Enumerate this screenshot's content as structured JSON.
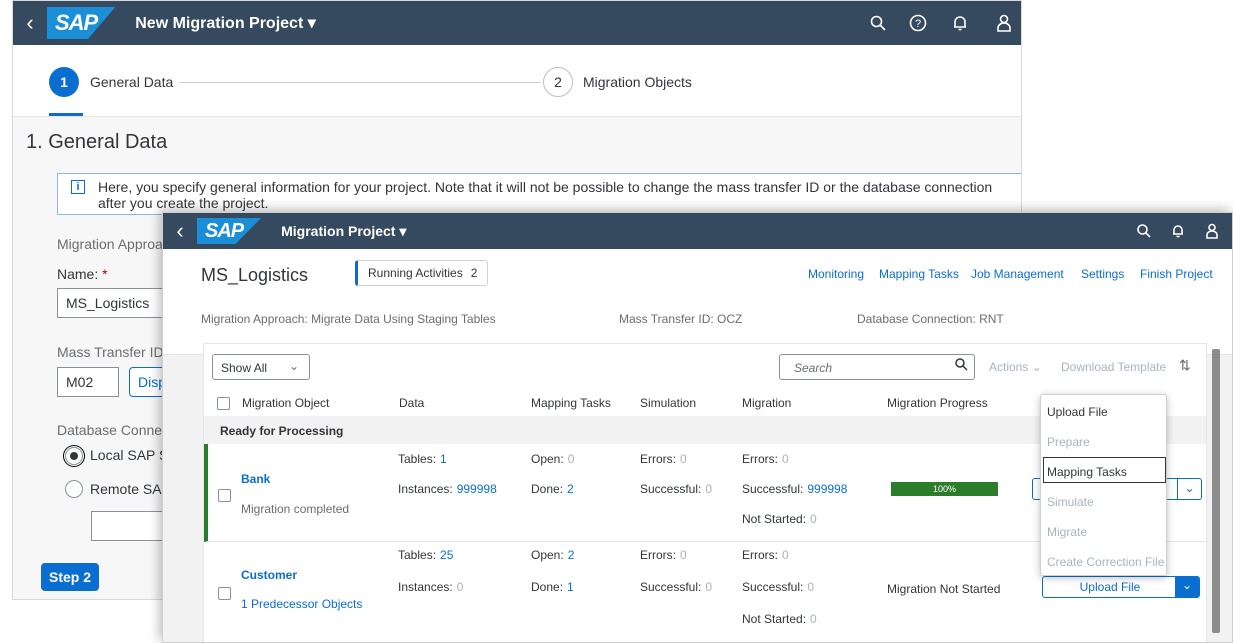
{
  "back": {
    "shell": {
      "title": "New Migration Project ▾",
      "logo": "SAP"
    },
    "steps": [
      {
        "number": "1",
        "label": "General Data"
      },
      {
        "number": "2",
        "label": "Migration Objects"
      }
    ],
    "heading": "1. General Data",
    "info_line1": "Here, you specify general information for your project. Note that it will not be possible to change the mass transfer ID or the database connection",
    "info_line2": "after you create the project.",
    "migration_approach_label": "Migration Approa",
    "name_label": "Name:",
    "name_required": "*",
    "name_value": "MS_Logistics",
    "mass_transfer_label": "Mass Transfer ID",
    "mass_transfer_value": "M02",
    "display_button": "Disp",
    "db_connection_label": "Database Conne",
    "radio_local": "Local SAP S",
    "radio_remote": "Remote SAI",
    "step2_button": "Step 2"
  },
  "front": {
    "shell": {
      "title": "Migration Project ▾",
      "logo": "SAP"
    },
    "project_name": "MS_Logistics",
    "running_activities": {
      "label": "Running Activities",
      "count": "2"
    },
    "header_links": [
      "Monitoring",
      "Mapping Tasks",
      "Job Management",
      "Settings",
      "Finish Project"
    ],
    "migration_approach": "Migration Approach: Migrate Data Using Staging Tables",
    "mass_transfer_id": "Mass Transfer ID: OCZ",
    "database_connection": "Database Connection: RNT",
    "toolbar": {
      "show_all": "Show All",
      "search_placeholder": "Search",
      "actions": "Actions",
      "download_template": "Download Template"
    },
    "columns": [
      "Migration Object",
      "Data",
      "Mapping Tasks",
      "Simulation",
      "Migration",
      "Migration Progress"
    ],
    "group_header": "Ready for Processing",
    "rows": [
      {
        "name": "Bank",
        "sub": "Migration completed",
        "tables_label": "Tables:",
        "tables": "1",
        "instances_label": "Instances:",
        "instances": "999998",
        "open_label": "Open:",
        "open": "0",
        "done_label": "Done:",
        "done": "2",
        "sim_errors_label": "Errors:",
        "sim_errors": "0",
        "sim_success_label": "Successful:",
        "sim_success": "0",
        "mig_errors_label": "Errors:",
        "mig_errors": "0",
        "mig_success_label": "Successful:",
        "mig_success": "999998",
        "mig_notstarted_label": "Not Started:",
        "mig_notstarted": "0",
        "progress_text": "100%",
        "progress_fraction": 1.0
      },
      {
        "name": "Customer",
        "sub": "1 Predecessor Objects",
        "tables_label": "Tables:",
        "tables": "25",
        "instances_label": "Instances:",
        "instances": "0",
        "open_label": "Open:",
        "open": "2",
        "done_label": "Done:",
        "done": "1",
        "sim_errors_label": "Errors:",
        "sim_errors": "0",
        "sim_success_label": "Successful:",
        "sim_success": "0",
        "mig_errors_label": "Errors:",
        "mig_errors": "0",
        "mig_success_label": "Successful:",
        "mig_success": "0",
        "mig_notstarted_label": "Not Started:",
        "mig_notstarted": "0",
        "progress_text": "Migration Not Started",
        "action_button": "Upload File"
      }
    ],
    "menu": [
      "Upload File",
      "Prepare",
      "Mapping Tasks",
      "Simulate",
      "Migrate",
      "Create Correction File"
    ]
  },
  "colors": {
    "shell": "#354a5f",
    "accent": "#0a6ed1",
    "success": "#2b7d2b",
    "sap_blue": "#1a8fd8"
  }
}
